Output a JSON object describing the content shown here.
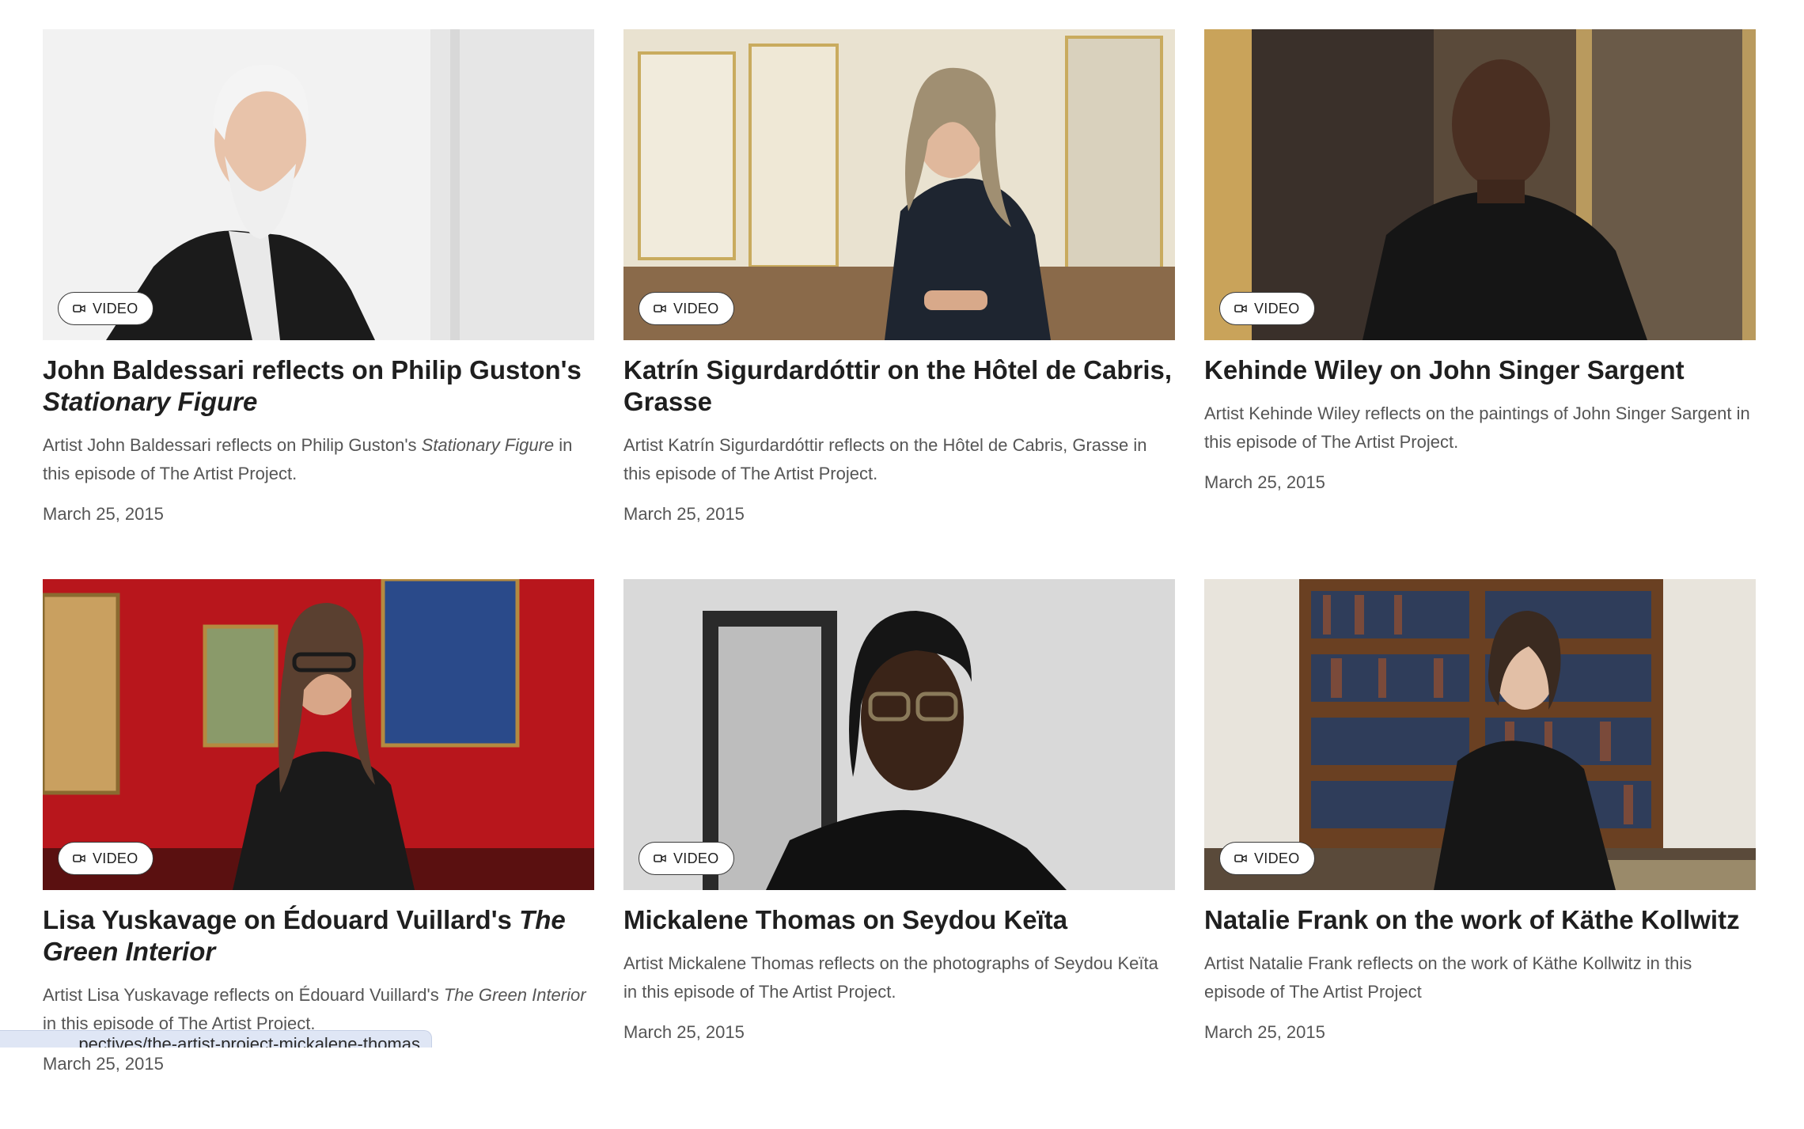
{
  "cards": [
    {
      "badge": "VIDEO",
      "title_plain": "John Baldessari reflects on Philip Guston's ",
      "title_italic": "Stationary Figure",
      "desc_plain": "Artist John Baldessari reflects on Philip Guston's ",
      "desc_italic": "Stationary Figure",
      "desc_after": " in this episode of The Artist Project.",
      "date": "March 25, 2015"
    },
    {
      "badge": "VIDEO",
      "title_plain": "Katrín Sigurdardóttir on the Hôtel de Cabris, Grasse",
      "title_italic": "",
      "desc_plain": "Artist Katrín Sigurdardóttir reflects on the Hôtel de Cabris, Grasse in this episode of The Artist Project.",
      "desc_italic": "",
      "desc_after": "",
      "date": "March 25, 2015"
    },
    {
      "badge": "VIDEO",
      "title_plain": "Kehinde Wiley on John Singer Sargent",
      "title_italic": "",
      "desc_plain": "Artist Kehinde Wiley reflects on the paintings of John Singer Sargent in this episode of The Artist Project.",
      "desc_italic": "",
      "desc_after": "",
      "date": "March 25, 2015"
    },
    {
      "badge": "VIDEO",
      "title_plain": "Lisa Yuskavage on Édouard Vuillard's ",
      "title_italic": "The Green Interior",
      "desc_plain": "Artist Lisa Yuskavage reflects on Édouard Vuillard's ",
      "desc_italic": "The Green Interior",
      "desc_after": " in this episode of The Artist Project.",
      "date": "March 25, 2015"
    },
    {
      "badge": "VIDEO",
      "title_plain": "Mickalene Thomas on Seydou Keïta",
      "title_italic": "",
      "desc_plain": "Artist Mickalene Thomas reflects on the photographs of Seydou Keïta in this episode of The Artist Project.",
      "desc_italic": "",
      "desc_after": "",
      "date": "March 25, 2015"
    },
    {
      "badge": "VIDEO",
      "title_plain": "Natalie Frank on the work of Käthe Kollwitz",
      "title_italic": "",
      "desc_plain": "Artist Natalie Frank reflects on the work of Käthe Kollwitz in this episode of The Artist Project",
      "desc_italic": "",
      "desc_after": "",
      "date": "March 25, 2015"
    }
  ],
  "status_url": "pectives/the-artist-project-mickalene-thomas",
  "icons": {
    "badge": "video-camera-icon"
  },
  "colors": {
    "text": "#1f1f1f",
    "muted": "#555555",
    "tooltip": "#dfe6f5"
  }
}
